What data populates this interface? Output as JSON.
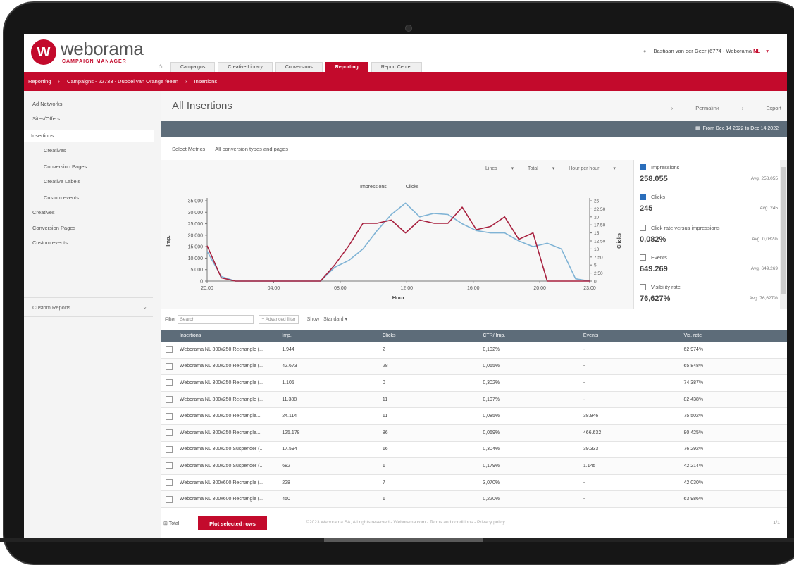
{
  "colors": {
    "brand": "#c30a2c",
    "header_bar": "#5d6c79",
    "impressions_line": "#7fb3d5",
    "clicks_line": "#a8213f"
  },
  "app": {
    "logo_mark": "w",
    "logo_name": "weborama",
    "logo_sub": "CAMPAIGN MANAGER",
    "user_icon": "user-icon",
    "user_label": "Bastiaan van der Geer (6774 - Weborama",
    "user_country": "NL"
  },
  "tabs": [
    {
      "label": "Campaigns",
      "active": false
    },
    {
      "label": "Creative Library",
      "active": false
    },
    {
      "label": "Conversions",
      "active": false
    },
    {
      "label": "Reporting",
      "active": true
    },
    {
      "label": "Report Center",
      "active": false
    }
  ],
  "breadcrumb": [
    "Reporting",
    "Campaigns - 22733 - Dubbel van Orange feeen",
    "Insertions"
  ],
  "sidebar": {
    "items": [
      {
        "label": "Ad Networks",
        "level": 0,
        "selected": false
      },
      {
        "label": "Sites/Offers",
        "level": 0,
        "selected": false
      },
      {
        "label": "Insertions",
        "level": 0,
        "selected": true
      },
      {
        "label": "Creatives",
        "level": 1,
        "selected": false
      },
      {
        "label": "Conversion Pages",
        "level": 1,
        "selected": false
      },
      {
        "label": "Creative Labels",
        "level": 1,
        "selected": false
      },
      {
        "label": "Custom events",
        "level": 1,
        "selected": false
      },
      {
        "label": "Creatives",
        "level": 0,
        "selected": false
      },
      {
        "label": "Conversion Pages",
        "level": 0,
        "selected": false
      },
      {
        "label": "Custom events",
        "level": 0,
        "selected": false
      }
    ],
    "custom_reports": "Custom Reports"
  },
  "main": {
    "title": "All Insertions",
    "permalink": "Permalink",
    "export": "Export",
    "date_range": "From Dec 14 2022 to Dec 14 2022",
    "select_metrics": "Select Metrics",
    "metrics_value": "All conversion types and pages"
  },
  "chart_controls": [
    "Lines",
    "Total",
    "Hour per hour"
  ],
  "metrics": [
    {
      "label": "Impressions",
      "value": "258.055",
      "avg": "Avg. 258.055",
      "checked": true
    },
    {
      "label": "Clicks",
      "value": "245",
      "avg": "Avg. 245",
      "checked": true
    },
    {
      "label": "Click rate versus impressions",
      "value": "0,082%",
      "avg": "Avg. 0,082%",
      "checked": false
    },
    {
      "label": "Events",
      "value": "649.269",
      "avg": "Avg. 649.269",
      "checked": false
    },
    {
      "label": "Visibility rate",
      "value": "76,627%",
      "avg": "Avg. 76,627%",
      "checked": false
    }
  ],
  "filter": {
    "label": "Filter",
    "placeholder": "Search",
    "advanced": "Advanced filter",
    "show_label": "Show",
    "show_value": "Standard"
  },
  "table": {
    "columns": [
      "Insertions",
      "Imp.",
      "Clicks",
      "CTR/ Imp.",
      "Events",
      "Vis. rate"
    ],
    "rows": [
      [
        "Weborama NL 300x250 Rechangle (...",
        "1.944",
        "2",
        "0,102%",
        "-",
        "62,974%"
      ],
      [
        "Weborama NL 300x250 Rechangle (...",
        "42.673",
        "28",
        "0,065%",
        "-",
        "65,848%"
      ],
      [
        "Weborama NL 300x250 Rechangle (...",
        "1.105",
        "0",
        "0,302%",
        "-",
        "74,387%"
      ],
      [
        "Weborama NL 300x250 Rechangle (...",
        "11.388",
        "11",
        "0,107%",
        "-",
        "82,438%"
      ],
      [
        "Weborama NL 300x250 Rechangle...",
        "24.114",
        "11",
        "0,085%",
        "38.946",
        "75,502%"
      ],
      [
        "Weborama NL 300x250 Rechangle...",
        "125.178",
        "86",
        "0,069%",
        "466.632",
        "80,425%"
      ],
      [
        "Weborama NL 300x250 Suspender (...",
        "17.594",
        "16",
        "0,304%",
        "39.333",
        "76,292%"
      ],
      [
        "Weborama NL 300x250 Suspender (...",
        "682",
        "1",
        "0,179%",
        "1.145",
        "42,214%"
      ],
      [
        "Weborama NL 300x600 Rechangle (...",
        "228",
        "7",
        "3,070%",
        "-",
        "42,030%"
      ],
      [
        "Weborama NL 300x600 Rechangle (...",
        "450",
        "1",
        "0,220%",
        "-",
        "63,986%"
      ]
    ]
  },
  "footer": {
    "total": "Total",
    "plot_button": "Plot selected rows",
    "pager": "1/1",
    "copyright": "©2023 Weborama SA, All rights reserved - Weborama.com - Terms and conditions - Privacy policy"
  },
  "chart_data": {
    "type": "line",
    "xlabel": "Hour",
    "ylabel": "Imp.",
    "y2label": "Clicks",
    "x_ticks": [
      "20:00",
      "04:00",
      "08:00",
      "12:00",
      "16:00",
      "20:00",
      "23:00"
    ],
    "y_ticks": [
      "0",
      "5.000",
      "10.000",
      "15.000",
      "20.000",
      "25.000",
      "30.000",
      "35.000"
    ],
    "y2_ticks": [
      "0",
      "2,50",
      "5",
      "7,50",
      "10",
      "12,50",
      "15",
      "17,50",
      "20",
      "22,50",
      "25"
    ],
    "ylim": [
      0,
      35000
    ],
    "y2lim": [
      0,
      25
    ],
    "categories": [
      "20:00",
      "21:00",
      "22:00",
      "23:00",
      "00:00",
      "01:00",
      "02:00",
      "03:00",
      "04:00",
      "05:00",
      "06:00",
      "07:00",
      "08:00",
      "09:00",
      "10:00",
      "11:00",
      "12:00",
      "13:00",
      "14:00",
      "15:00",
      "16:00",
      "17:00",
      "18:00",
      "19:00",
      "20:00",
      "21:00",
      "22:00",
      "23:00"
    ],
    "legend": [
      "Impressions",
      "Clicks"
    ],
    "series": [
      {
        "name": "Impressions",
        "axis": "left",
        "values": [
          13000,
          2000,
          0,
          0,
          0,
          0,
          0,
          0,
          0,
          6000,
          9000,
          14000,
          22000,
          29000,
          34000,
          28000,
          29500,
          29000,
          25000,
          22000,
          21000,
          21000,
          17500,
          15000,
          16500,
          14000,
          1000,
          0
        ]
      },
      {
        "name": "Clicks",
        "axis": "right",
        "values": [
          11,
          1,
          0,
          0,
          0,
          0,
          0,
          0,
          0,
          5,
          11,
          18,
          18,
          19,
          15,
          19,
          18,
          18,
          23,
          16,
          17,
          20,
          13,
          15,
          0,
          0,
          0,
          0
        ]
      }
    ],
    "grid": false,
    "legend_position": "top-center"
  }
}
